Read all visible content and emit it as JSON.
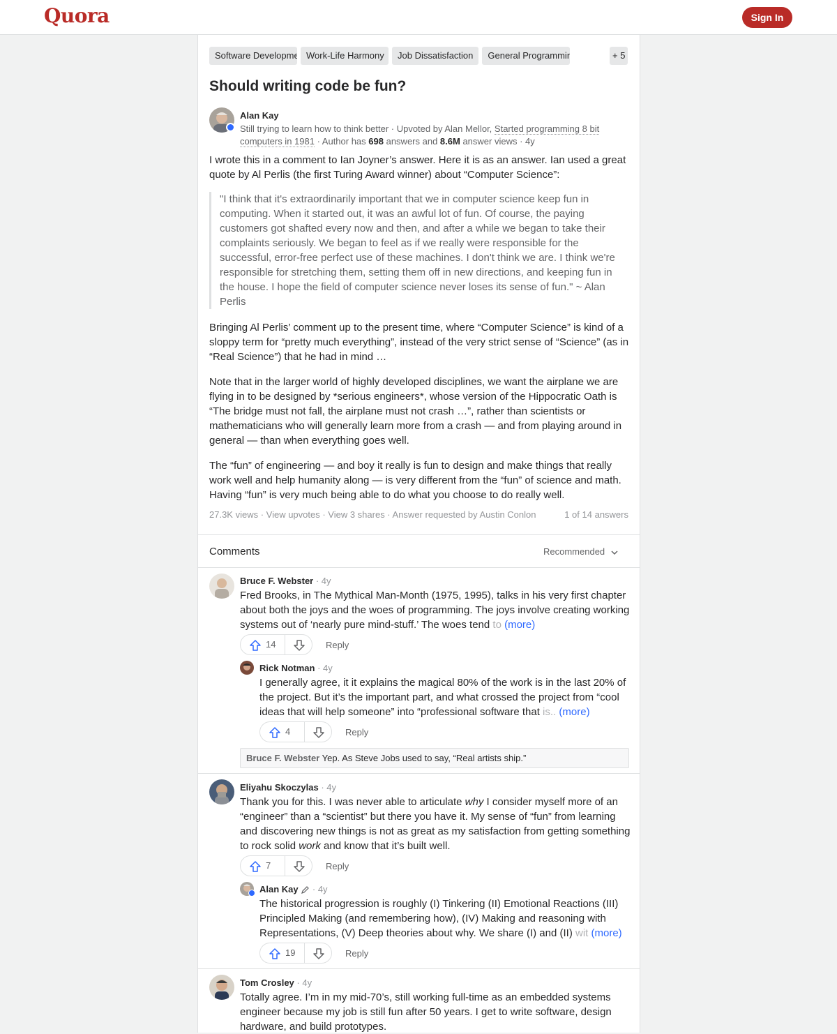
{
  "header": {
    "logo": "Quora",
    "signin_label": "Sign In"
  },
  "topics": [
    "Software Development",
    "Work-Life Harmony",
    "Job Dissatisfaction",
    "General Programming"
  ],
  "topics_more": "+ 5",
  "question": {
    "title": "Should writing code be fun?"
  },
  "answer": {
    "author": "Alan Kay",
    "cred_1": "Still trying to learn how to think better · Upvoted by Alan Mellor, ",
    "cred_link_a": "Started programming 8 bit",
    "cred_link_b": "computers in 1981",
    "cred_2": " · Author has ",
    "answers_count": "698",
    "cred_3": " answers and ",
    "views_count": "8.6M",
    "cred_4": " answer views · 4y",
    "p1": "I wrote this in a comment to Ian Joyner’s answer. Here it is as an answer. Ian used a great quote by Al Perlis (the first Turing Award winner) about “Computer Science”:",
    "quote": "\"I think that it's extraordinarily important that we in computer science keep fun in computing. When it started out, it was an awful lot of fun. Of course, the paying customers got shafted every now and then, and after a while we began to take their complaints seriously. We began to feel as if we really were responsible for the successful, error-free perfect use of these machines. I don't think we are. I think we're responsible for stretching them, setting them off in new directions, and keeping fun in the house. I hope the field of computer science never loses its sense of fun.\" ~ Alan Perlis",
    "p2": "Bringing Al Perlis’ comment up to the present time, where “Computer Science” is kind of a sloppy term for “pretty much everything”, instead of the very strict sense of “Science” (as in “Real Science”) that he had in mind …",
    "p3": "Note that in the larger world of highly developed disciplines, we want the airplane we are flying in to be designed by *serious engineers*, whose version of the Hippocratic Oath is “The bridge must not fall, the airplane must not crash …”, rather than scientists or mathematicians who will generally learn more from a crash — and from playing around in general — than when everything goes well.",
    "p4": "The “fun” of engineering — and boy it really is fun to design and make things that really work well and help humanity along — is very different from the “fun” of science and math. Having “fun” is very much being able to do what you choose to do really well.",
    "stats": "27.3K views · View upvotes · View 3 shares · Answer requested by Austin Conlon",
    "answer_count": "1 of 14 answers"
  },
  "comments_section": {
    "title": "Comments",
    "sort": "Recommended"
  },
  "comments": {
    "c1": {
      "author": "Bruce F. Webster",
      "time": " · 4y",
      "text": "Fred Brooks, in The Mythical Man-Month (1975, 1995), talks in his very first chapter about both the joys and the woes of programming. The joys involve creating working systems out of ‘nearly pure mind-stuff.’ The woes tend",
      "fade": " to",
      "more": "(more)",
      "upvotes": "14",
      "reply": "Reply"
    },
    "c1r": {
      "author": "Rick Notman",
      "time": " · 4y",
      "text": "I generally agree, it it explains the magical 80% of the work is in the last 20% of the project. But it’s the important part, and what crossed the project from “cool ideas that will help someone” into “professional software that",
      "fade": " is..",
      "more": "(more)",
      "upvotes": "4",
      "reply": "Reply"
    },
    "c1r_nested": {
      "author": "Bruce F. Webster",
      "text": " Yep. As Steve Jobs used to say, “Real artists ship.”"
    },
    "c2": {
      "author": "Eliyahu Skoczylas",
      "time": " · 4y",
      "text_a": "Thank you for this. I was never able to articulate ",
      "em_1": "why",
      "text_b": " I consider myself more of an “engineer” than a “scientist” but there you have it. My sense of “fun” from learning and discovering new things is not as great as my satisfaction from getting something to rock solid ",
      "em_2": "work",
      "text_c": " and know that it’s built well.",
      "upvotes": "7",
      "reply": "Reply"
    },
    "c2r": {
      "author": "Alan Kay",
      "time": " · 4y",
      "text": "The historical progression is roughly (I) Tinkering (II) Emotional Reactions (III) Principled Making (and remembering how), (IV) Making and reasoning with Representations, (V) Deep theories about why. We share (I) and (II)",
      "fade": " wit",
      "more": "(more)",
      "upvotes": "19",
      "reply": "Reply"
    },
    "c3": {
      "author": "Tom Crosley",
      "time": " · 4y",
      "text": "Totally agree. I’m in my mid-70’s, still working full-time as an embedded systems engineer because my job is still fun after 50 years. I get to write software, design hardware, and build prototypes."
    }
  }
}
